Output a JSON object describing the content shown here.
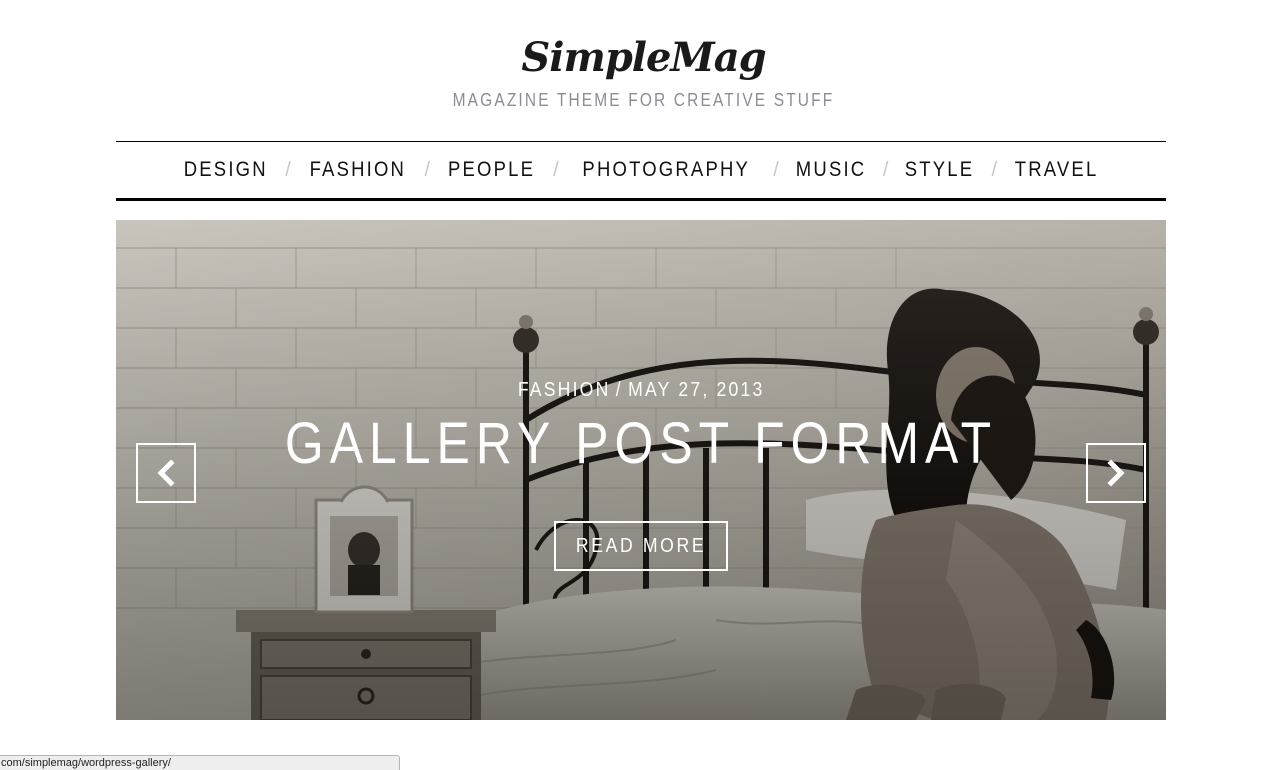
{
  "header": {
    "logo": "SimpleMag",
    "tagline": "MAGAZINE THEME FOR CREATIVE STUFF"
  },
  "nav": {
    "items": [
      {
        "label": "DESIGN"
      },
      {
        "label": "FASHION"
      },
      {
        "label": "PEOPLE"
      },
      {
        "label": "PHOTOGRAPHY"
      },
      {
        "label": "MUSIC"
      },
      {
        "label": "STYLE"
      },
      {
        "label": "TRAVEL"
      }
    ],
    "separator": "/"
  },
  "slider": {
    "category": "FASHION",
    "meta_separator": "/",
    "date": "MAY 27, 2013",
    "title": "GALLERY POST FORMAT",
    "read_more_label": "READ MORE",
    "prev_icon": "chevron-left-icon",
    "next_icon": "chevron-right-icon"
  },
  "status_bar": {
    "url": "com/simplemag/wordpress-gallery/"
  },
  "colors": {
    "tagline": "#8b8d96",
    "nav_text": "#111111",
    "nav_separator": "#c8c8c8",
    "overlay_text": "#ffffff"
  }
}
